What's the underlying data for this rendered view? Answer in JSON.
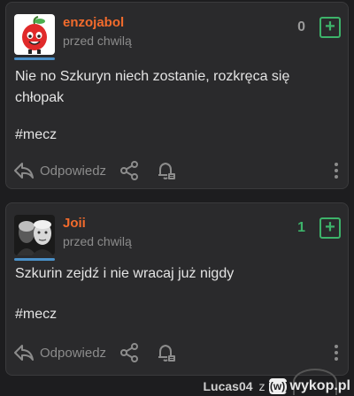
{
  "entries": [
    {
      "username": "enzojabol",
      "time": "przed chwilą",
      "votes": "0",
      "text": "Nie no Szkuryn niech zostanie, rozkręca się chłopak",
      "tag": "#mecz",
      "reply_label": "Odpowiedz"
    },
    {
      "username": "Joii",
      "time": "przed chwilą",
      "votes": "1",
      "text": "Szkurin zejdź i nie wracaj już nigdy",
      "tag": "#mecz",
      "reply_label": "Odpowiedz"
    }
  ],
  "footer": {
    "user": "Lucas04",
    "connector": "z",
    "site": "wykop.pl"
  },
  "colors": {
    "username": "#f26b2c",
    "vote_green": "#3db36a",
    "card_bg": "#2a2a2c",
    "page_bg": "#1d1d1f"
  },
  "icons": [
    "reply-icon",
    "share-icon",
    "bell-icon",
    "more-icon",
    "plus-icon"
  ]
}
